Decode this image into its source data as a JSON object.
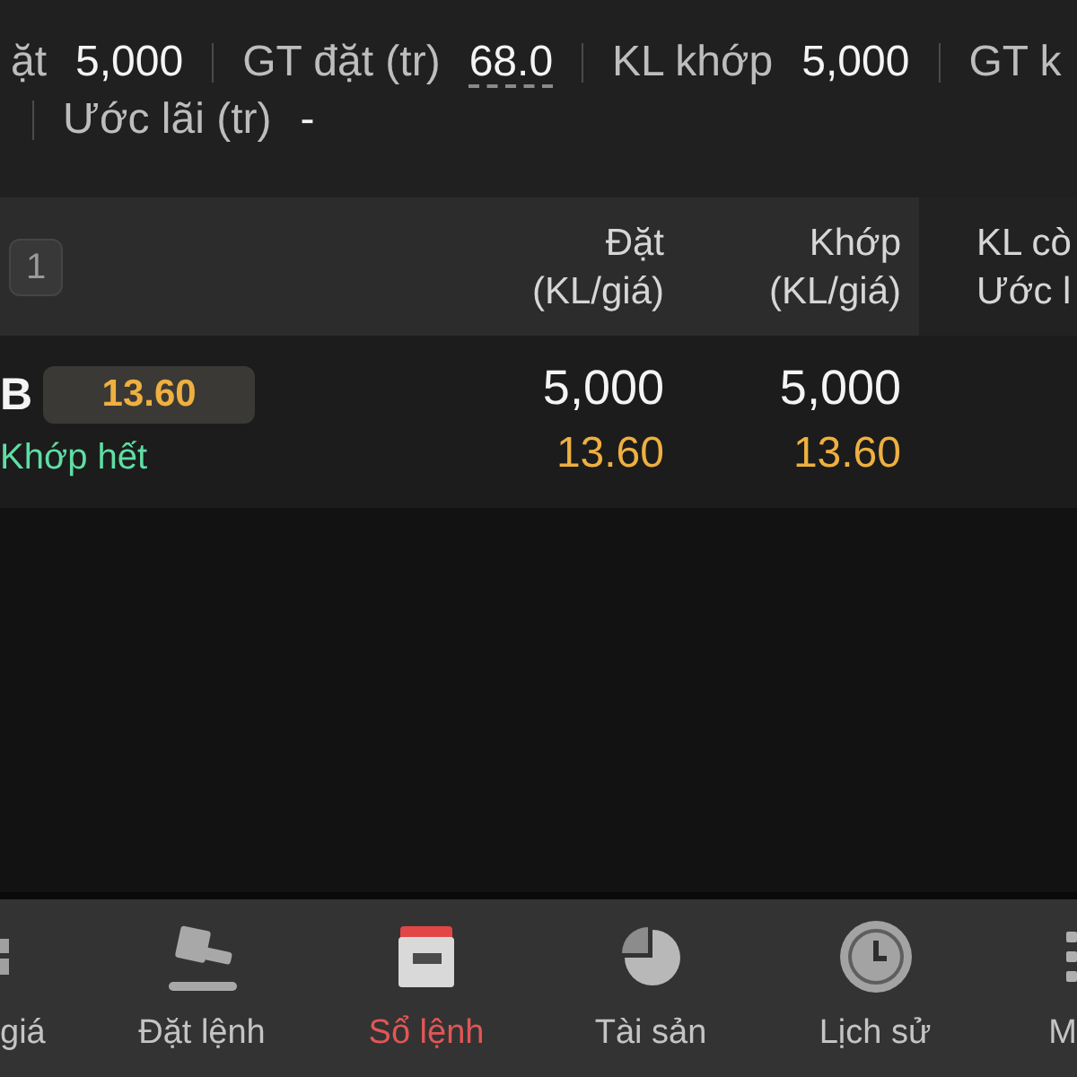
{
  "summary": {
    "lines": [
      {
        "leading_separator": false,
        "items": [
          {
            "label": "ặt",
            "value": "5,000",
            "underlined": false
          },
          {
            "label": "GT đặt (tr)",
            "value": "68.0",
            "underlined": true
          },
          {
            "label": "KL khớp",
            "value": "5,000",
            "underlined": false
          },
          {
            "label": "GT k"
          }
        ]
      },
      {
        "leading_separator": true,
        "items": [
          {
            "label": "Ước lãi (tr)",
            "value": "-",
            "underlined": false
          }
        ]
      }
    ]
  },
  "table": {
    "badge": "1",
    "columns": [
      {
        "label": "Đặt\n(KL/giá)"
      },
      {
        "label": "Khớp\n(KL/giá)"
      },
      {
        "label": "KL cò\nƯớc l"
      }
    ],
    "rows": [
      {
        "symbol": "B",
        "price": "13.60",
        "status": "Khớp hết",
        "order": {
          "quantity": "5,000",
          "price": "13.60"
        },
        "matched": {
          "quantity": "5,000",
          "price": "13.60"
        }
      }
    ]
  },
  "bottom_nav": [
    {
      "label": "giá",
      "selected": false
    },
    {
      "label": "Đặt lệnh",
      "selected": false
    },
    {
      "label": "Sổ lệnh",
      "selected": true
    },
    {
      "label": "Tài sản",
      "selected": false
    },
    {
      "label": "Lịch sử",
      "selected": false
    },
    {
      "label": "M",
      "selected": false
    }
  ]
}
